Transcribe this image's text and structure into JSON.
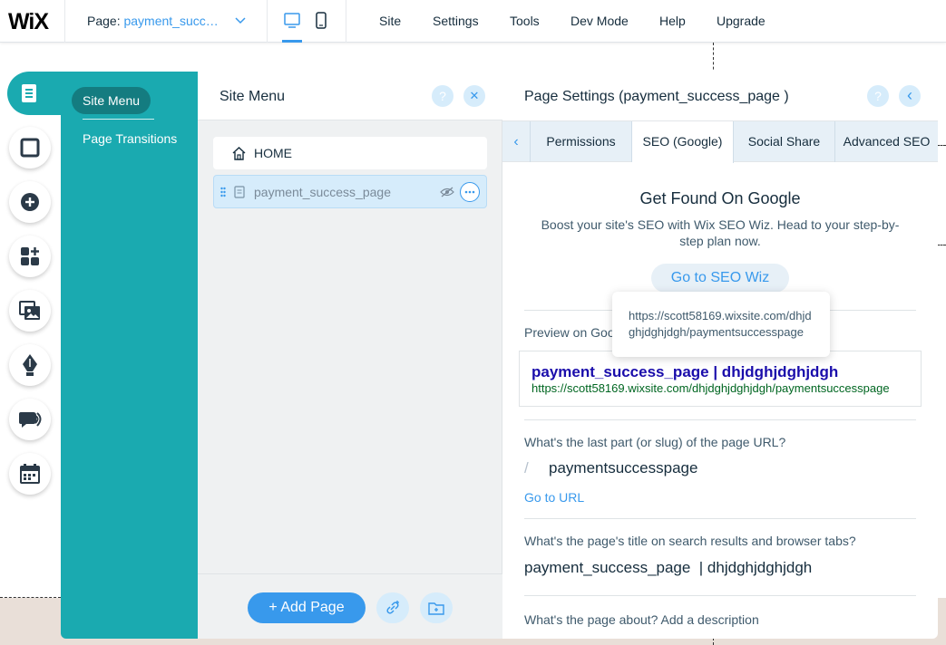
{
  "topbar": {
    "logo": "WiX",
    "page_label": "Page:",
    "page_value": "payment_succ…",
    "menu": [
      "Site",
      "Settings",
      "Tools",
      "Dev Mode",
      "Help",
      "Upgrade"
    ]
  },
  "icons": {
    "chevron": "chevron-down-icon",
    "desktop": "desktop-icon",
    "mobile": "mobile-icon",
    "tools": [
      "pages-icon",
      "background-icon",
      "add-icon",
      "apps-icon",
      "media-icon",
      "blog-icon",
      "chat-icon",
      "bookings-icon"
    ]
  },
  "teal_panel": {
    "active": "Site Menu",
    "link": "Page Transitions"
  },
  "site_menu": {
    "title": "Site Menu",
    "help": "?",
    "close": "✕",
    "items": [
      {
        "label": "HOME"
      },
      {
        "label": "payment_success_page"
      }
    ],
    "add_page": "+ Add Page"
  },
  "page_settings": {
    "title": "Page Settings (payment_success_page )",
    "help": "?",
    "back": "‹",
    "tab_prev": "‹",
    "tabs": [
      "Permissions",
      "SEO (Google)",
      "Social Share",
      "Advanced SEO"
    ],
    "active_tab": "SEO (Google)",
    "seo_heading": "Get Found On Google",
    "seo_sub": "Boost your site's SEO with Wix SEO Wiz. Head to your step-by-step plan now.",
    "seo_button": "Go to SEO Wiz",
    "preview_label": "Preview on Goo",
    "google_title": "payment_success_page | dhjdghjdghjdgh",
    "google_url": "https://scott58169.wixsite.com/dhjdghjdghjdgh/paymentsuccesspage",
    "slug_question": "What's the last part (or slug) of the page URL?",
    "slug_slash": "/",
    "slug": "paymentsuccesspage",
    "go_to_url": "Go to URL",
    "title_question": "What's the page's title on search results and browser tabs?",
    "page_title_value": "payment_success_page  | dhjdghjdghjdgh",
    "desc_question": "What's the page about? Add a description"
  },
  "tooltip": {
    "text": "https://scott58169.wixsite.com/dhjdghjdghjdgh/paymentsuccesspage"
  }
}
